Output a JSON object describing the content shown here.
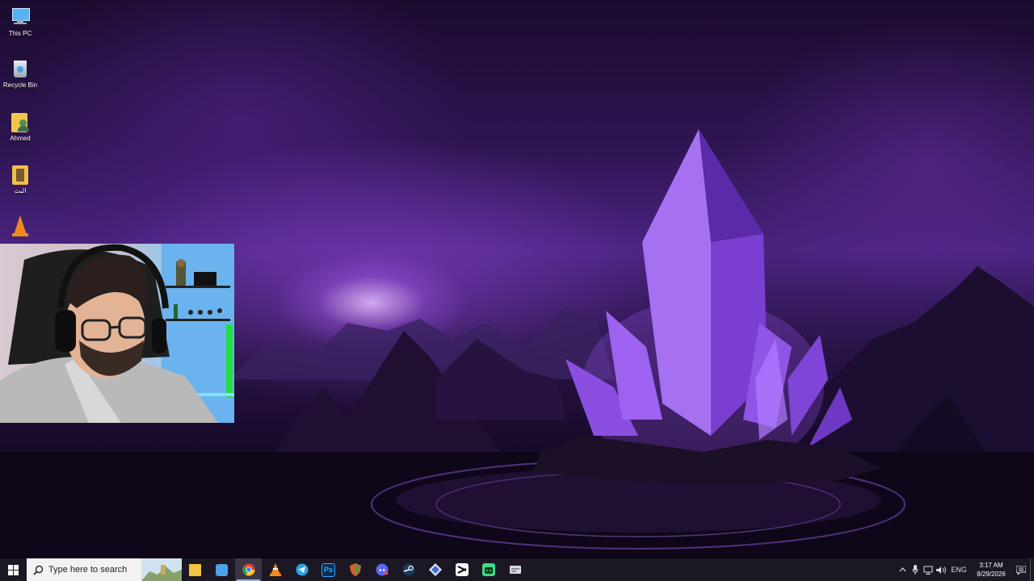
{
  "desktop": {
    "icons": [
      {
        "label": "This PC",
        "icon": "this-pc-icon"
      },
      {
        "label": "Recycle Bin",
        "icon": "recycle-bin-icon"
      },
      {
        "label": "Ahmed",
        "icon": "user-folder-icon"
      },
      {
        "label": "البث",
        "icon": "folder-icon"
      },
      {
        "label": "",
        "icon": "vlc-icon"
      }
    ]
  },
  "webcam": {
    "icon": "webcam-overlay"
  },
  "taskbar": {
    "search_placeholder": "Type here to search",
    "apps": [
      {
        "name": "File Explorer",
        "icon": "file-explorer-icon",
        "color": "#f3c341"
      },
      {
        "name": "Window",
        "icon": "window-app-icon",
        "color": "#4aa3e8"
      },
      {
        "name": "Chrome",
        "icon": "chrome-icon",
        "color": "#e34133",
        "active": true
      },
      {
        "name": "VLC",
        "icon": "vlc-icon",
        "color": "#f08a1c"
      },
      {
        "name": "Telegram",
        "icon": "telegram-icon",
        "color": "#2aa3df"
      },
      {
        "name": "Photoshop",
        "icon": "photoshop-icon",
        "color": "#0d2a52",
        "glyph": "Ps"
      },
      {
        "name": "Shield",
        "icon": "shield-app-icon",
        "color": "#d4612b"
      },
      {
        "name": "Discord",
        "icon": "discord-icon",
        "color": "#5865f2"
      },
      {
        "name": "Steam",
        "icon": "steam-icon",
        "color": "#1a3b5c"
      },
      {
        "name": "Git",
        "icon": "diamond-app-icon",
        "color": "#3b6fd0"
      },
      {
        "name": "CapCut",
        "icon": "capcut-icon",
        "color": "#222222"
      },
      {
        "name": "Android",
        "icon": "android-app-icon",
        "color": "#3ddc84"
      },
      {
        "name": "Storage",
        "icon": "drive-app-icon",
        "color": "#8a8f99"
      }
    ],
    "tray": {
      "language": "ENG",
      "time": "3:17 AM",
      "date": "8/29/2026"
    }
  }
}
